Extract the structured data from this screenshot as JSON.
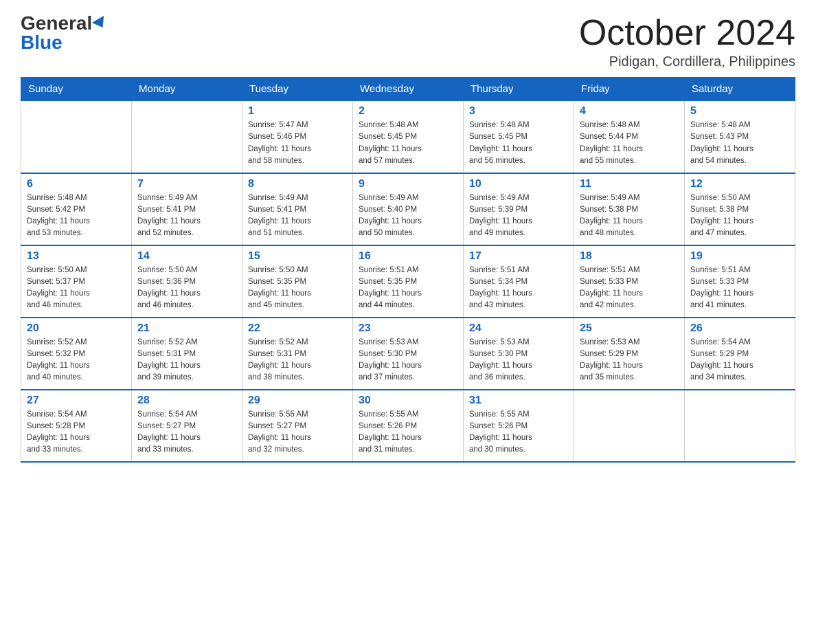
{
  "header": {
    "logo_general": "General",
    "logo_blue": "Blue",
    "month_title": "October 2024",
    "location": "Pidigan, Cordillera, Philippines"
  },
  "days_of_week": [
    "Sunday",
    "Monday",
    "Tuesday",
    "Wednesday",
    "Thursday",
    "Friday",
    "Saturday"
  ],
  "weeks": [
    [
      {
        "day": "",
        "info": ""
      },
      {
        "day": "",
        "info": ""
      },
      {
        "day": "1",
        "info": "Sunrise: 5:47 AM\nSunset: 5:46 PM\nDaylight: 11 hours\nand 58 minutes."
      },
      {
        "day": "2",
        "info": "Sunrise: 5:48 AM\nSunset: 5:45 PM\nDaylight: 11 hours\nand 57 minutes."
      },
      {
        "day": "3",
        "info": "Sunrise: 5:48 AM\nSunset: 5:45 PM\nDaylight: 11 hours\nand 56 minutes."
      },
      {
        "day": "4",
        "info": "Sunrise: 5:48 AM\nSunset: 5:44 PM\nDaylight: 11 hours\nand 55 minutes."
      },
      {
        "day": "5",
        "info": "Sunrise: 5:48 AM\nSunset: 5:43 PM\nDaylight: 11 hours\nand 54 minutes."
      }
    ],
    [
      {
        "day": "6",
        "info": "Sunrise: 5:48 AM\nSunset: 5:42 PM\nDaylight: 11 hours\nand 53 minutes."
      },
      {
        "day": "7",
        "info": "Sunrise: 5:49 AM\nSunset: 5:41 PM\nDaylight: 11 hours\nand 52 minutes."
      },
      {
        "day": "8",
        "info": "Sunrise: 5:49 AM\nSunset: 5:41 PM\nDaylight: 11 hours\nand 51 minutes."
      },
      {
        "day": "9",
        "info": "Sunrise: 5:49 AM\nSunset: 5:40 PM\nDaylight: 11 hours\nand 50 minutes."
      },
      {
        "day": "10",
        "info": "Sunrise: 5:49 AM\nSunset: 5:39 PM\nDaylight: 11 hours\nand 49 minutes."
      },
      {
        "day": "11",
        "info": "Sunrise: 5:49 AM\nSunset: 5:38 PM\nDaylight: 11 hours\nand 48 minutes."
      },
      {
        "day": "12",
        "info": "Sunrise: 5:50 AM\nSunset: 5:38 PM\nDaylight: 11 hours\nand 47 minutes."
      }
    ],
    [
      {
        "day": "13",
        "info": "Sunrise: 5:50 AM\nSunset: 5:37 PM\nDaylight: 11 hours\nand 46 minutes."
      },
      {
        "day": "14",
        "info": "Sunrise: 5:50 AM\nSunset: 5:36 PM\nDaylight: 11 hours\nand 46 minutes."
      },
      {
        "day": "15",
        "info": "Sunrise: 5:50 AM\nSunset: 5:35 PM\nDaylight: 11 hours\nand 45 minutes."
      },
      {
        "day": "16",
        "info": "Sunrise: 5:51 AM\nSunset: 5:35 PM\nDaylight: 11 hours\nand 44 minutes."
      },
      {
        "day": "17",
        "info": "Sunrise: 5:51 AM\nSunset: 5:34 PM\nDaylight: 11 hours\nand 43 minutes."
      },
      {
        "day": "18",
        "info": "Sunrise: 5:51 AM\nSunset: 5:33 PM\nDaylight: 11 hours\nand 42 minutes."
      },
      {
        "day": "19",
        "info": "Sunrise: 5:51 AM\nSunset: 5:33 PM\nDaylight: 11 hours\nand 41 minutes."
      }
    ],
    [
      {
        "day": "20",
        "info": "Sunrise: 5:52 AM\nSunset: 5:32 PM\nDaylight: 11 hours\nand 40 minutes."
      },
      {
        "day": "21",
        "info": "Sunrise: 5:52 AM\nSunset: 5:31 PM\nDaylight: 11 hours\nand 39 minutes."
      },
      {
        "day": "22",
        "info": "Sunrise: 5:52 AM\nSunset: 5:31 PM\nDaylight: 11 hours\nand 38 minutes."
      },
      {
        "day": "23",
        "info": "Sunrise: 5:53 AM\nSunset: 5:30 PM\nDaylight: 11 hours\nand 37 minutes."
      },
      {
        "day": "24",
        "info": "Sunrise: 5:53 AM\nSunset: 5:30 PM\nDaylight: 11 hours\nand 36 minutes."
      },
      {
        "day": "25",
        "info": "Sunrise: 5:53 AM\nSunset: 5:29 PM\nDaylight: 11 hours\nand 35 minutes."
      },
      {
        "day": "26",
        "info": "Sunrise: 5:54 AM\nSunset: 5:29 PM\nDaylight: 11 hours\nand 34 minutes."
      }
    ],
    [
      {
        "day": "27",
        "info": "Sunrise: 5:54 AM\nSunset: 5:28 PM\nDaylight: 11 hours\nand 33 minutes."
      },
      {
        "day": "28",
        "info": "Sunrise: 5:54 AM\nSunset: 5:27 PM\nDaylight: 11 hours\nand 33 minutes."
      },
      {
        "day": "29",
        "info": "Sunrise: 5:55 AM\nSunset: 5:27 PM\nDaylight: 11 hours\nand 32 minutes."
      },
      {
        "day": "30",
        "info": "Sunrise: 5:55 AM\nSunset: 5:26 PM\nDaylight: 11 hours\nand 31 minutes."
      },
      {
        "day": "31",
        "info": "Sunrise: 5:55 AM\nSunset: 5:26 PM\nDaylight: 11 hours\nand 30 minutes."
      },
      {
        "day": "",
        "info": ""
      },
      {
        "day": "",
        "info": ""
      }
    ]
  ]
}
